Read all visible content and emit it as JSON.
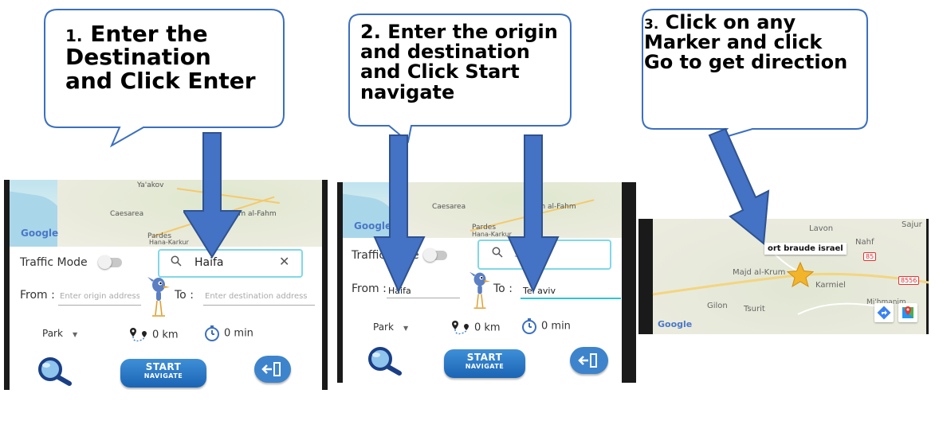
{
  "instructions": {
    "step1": {
      "number": "1.",
      "lines": [
        "Enter the",
        "Destination",
        "and Click Enter"
      ]
    },
    "step2": {
      "number": "2.",
      "lines": [
        "Enter the origin",
        "and destination",
        "and Click Start",
        "navigate"
      ]
    },
    "step3": {
      "number": "3.",
      "lines": [
        "Click on any",
        "Marker and click",
        "Go to get direction"
      ]
    }
  },
  "screen1": {
    "map_labels": [
      "Ya'akov",
      "Caesarea",
      "Umm al-Fahm",
      "Pardes",
      "Hana-Karkur"
    ],
    "google": "Google",
    "traffic_mode": "Traffic Mode",
    "search_value": "Haifa",
    "from_label": "From :",
    "from_placeholder": "Enter origin address",
    "to_label": "To :",
    "to_placeholder": "Enter destination address",
    "park": "Park",
    "distance": "0 km",
    "duration": "0 min",
    "start_l1": "START",
    "start_l2": "NAVIGATE"
  },
  "screen2": {
    "map_labels": [
      "Caesarea",
      "Umm al-Fahm",
      "Pardes",
      "Hana-Karkur"
    ],
    "google": "Google",
    "traffic_mode": "Traffic Mode",
    "search_placeholder": "Search",
    "from_label": "From :",
    "from_value": "Haifa",
    "to_label": "To :",
    "to_value": "Tel aviv",
    "park": "Park",
    "distance": "0 km",
    "duration": "0 min",
    "start_l1": "START",
    "start_l2": "NAVIGATE"
  },
  "screen3": {
    "labels": [
      "Lavon",
      "Sajur",
      "Nahf",
      "Majd al-Krum",
      "Karmiel",
      "Gilon",
      "Tsurit",
      "Mi'hmanim"
    ],
    "road_shields": [
      "85",
      "8556"
    ],
    "marker_callout": "ort braude israel",
    "google": "Google"
  },
  "colors": {
    "bubble_stroke": "#3b6fc0",
    "arrow": "#4472c4",
    "arrow_stroke": "#2f528f",
    "accent": "#2ec4d6",
    "button": "#2a74c4"
  }
}
